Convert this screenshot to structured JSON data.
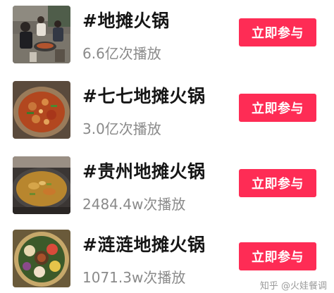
{
  "topics": [
    {
      "title": "#地摊火锅",
      "views": "6.6亿次播放",
      "button": "立即参与",
      "thumb_icon": "street-hotpot-crowd-photo"
    },
    {
      "title": "#七七地摊火锅",
      "views": "3.0亿次播放",
      "button": "立即参与",
      "thumb_icon": "spicy-hotpot-dish-photo"
    },
    {
      "title": "#贵州地摊火锅",
      "views": "2484.4w次播放",
      "button": "立即参与",
      "thumb_icon": "wok-hotpot-photo"
    },
    {
      "title": "#涟涟地摊火锅",
      "views": "1071.3w次播放",
      "button": "立即参与",
      "thumb_icon": "hotpot-platter-photo"
    }
  ],
  "watermark": "知乎 @火娃餐调",
  "colors": {
    "button_bg": "#fe2c55",
    "title": "#161616",
    "views": "#8a8a8a"
  }
}
